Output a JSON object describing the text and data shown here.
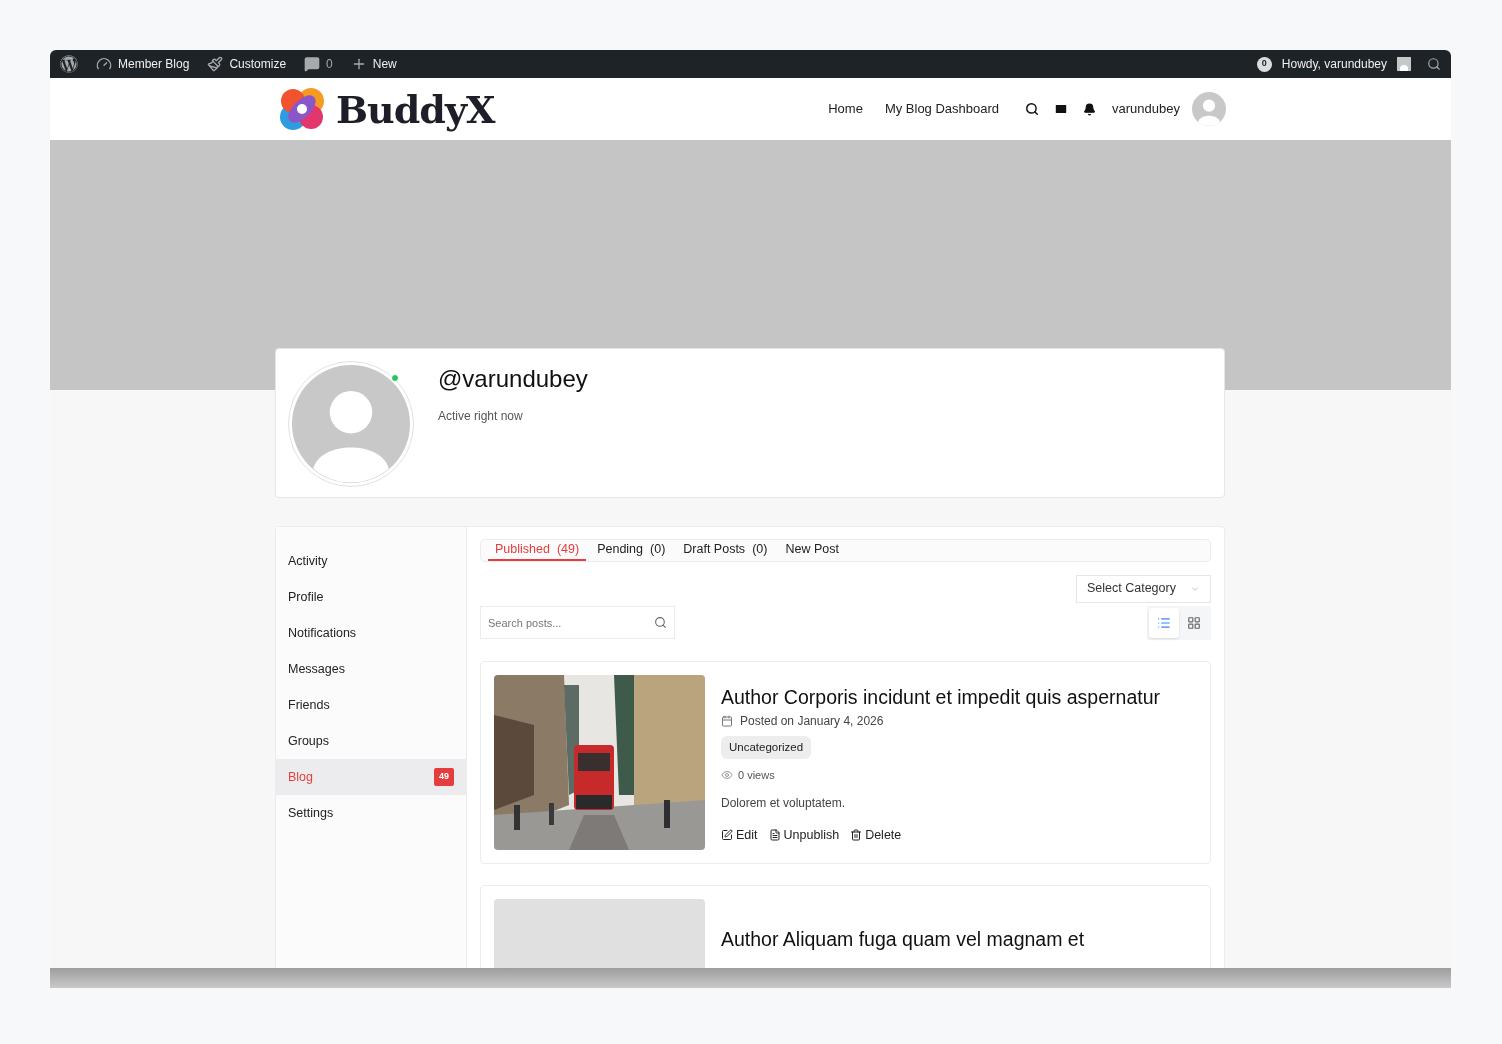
{
  "admin_bar": {
    "items": [
      {
        "kind": "logo"
      },
      {
        "kind": "dashboard",
        "label": "Member Blog"
      },
      {
        "kind": "customize",
        "label": "Customize"
      },
      {
        "kind": "comments",
        "label": "0"
      },
      {
        "kind": "new",
        "label": "New"
      }
    ],
    "notification_count": "0",
    "greeting": "Howdy, varundubey"
  },
  "header": {
    "logo_text": "BuddyX",
    "nav": [
      "Home",
      "My Blog Dashboard"
    ],
    "username": "varundubey"
  },
  "profile": {
    "handle": "@varundubey",
    "status": "Active right now",
    "online": true
  },
  "sidebar": {
    "items": [
      {
        "label": "Activity",
        "selected": false
      },
      {
        "label": "Profile",
        "selected": false
      },
      {
        "label": "Notifications",
        "selected": false
      },
      {
        "label": "Messages",
        "selected": false
      },
      {
        "label": "Friends",
        "selected": false
      },
      {
        "label": "Groups",
        "selected": false
      },
      {
        "label": "Blog",
        "selected": true,
        "badge": "49"
      },
      {
        "label": "Settings",
        "selected": false
      }
    ]
  },
  "tabs": [
    {
      "label": "Published",
      "count": "(49)",
      "selected": true
    },
    {
      "label": "Pending",
      "count": "(0)",
      "selected": false
    },
    {
      "label": "Draft Posts",
      "count": "(0)",
      "selected": false
    },
    {
      "label": "New Post",
      "selected": false
    }
  ],
  "category_select": "Select Category",
  "search": {
    "placeholder": "Search posts..."
  },
  "view_toggle": [
    {
      "kind": "list",
      "selected": true
    },
    {
      "kind": "grid",
      "selected": false
    }
  ],
  "posts": [
    {
      "kind": "picture",
      "title": "Author Corporis incidunt et impedit quis aspernatur",
      "date": "Posted on January 4, 2026",
      "category": "Uncategorized",
      "views": "0 views",
      "excerpt": "Dolorem et voluptatem.",
      "actions": [
        {
          "kind": "edit",
          "label": "Edit"
        },
        {
          "kind": "unpublish",
          "label": "Unpublish"
        },
        {
          "kind": "delete",
          "label": "Delete"
        }
      ]
    },
    {
      "kind": "placeholder",
      "title": "Author Aliquam fuga quam vel magnam et"
    }
  ]
}
